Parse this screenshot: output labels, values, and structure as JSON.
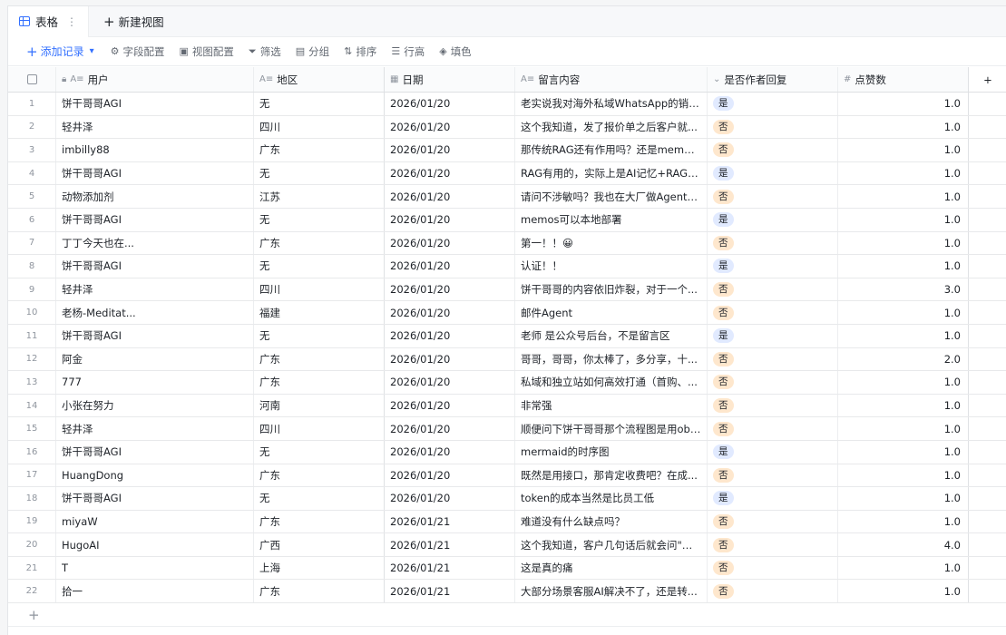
{
  "viewbar": {
    "active_tab": "表格",
    "new_view": "新建视图"
  },
  "toolbar": {
    "add_record": "添加记录",
    "field_config": "字段配置",
    "view_config": "视图配置",
    "filter": "筛选",
    "group": "分组",
    "sort": "排序",
    "row_height": "行高",
    "fill_color": "填色"
  },
  "columns": {
    "user": "用户",
    "region": "地区",
    "date": "日期",
    "message": "留言内容",
    "reply": "是否作者回复",
    "likes": "点赞数"
  },
  "colors": {
    "accent": "#3370ff",
    "tag_yes_bg": "#e1eaff",
    "tag_no_bg": "#fee7cd"
  },
  "rows": [
    {
      "no": "1",
      "user": "饼干哥哥AGI",
      "region": "无",
      "date": "2026/01/20",
      "message": "老实说我对海外私域WhatsApp的销售...",
      "reply": "是",
      "likes": "1.0"
    },
    {
      "no": "2",
      "user": "轻井泽",
      "region": "四川",
      "date": "2026/01/20",
      "message": "这个我知道，发了报价单之后客户就...",
      "reply": "否",
      "likes": "1.0"
    },
    {
      "no": "3",
      "user": "imbilly88",
      "region": "广东",
      "date": "2026/01/20",
      "message": "那传统RAG还有作用吗？还是mem使...",
      "reply": "否",
      "likes": "1.0"
    },
    {
      "no": "4",
      "user": "饼干哥哥AGI",
      "region": "无",
      "date": "2026/01/20",
      "message": "RAG有用的，实际上是AI记忆+RAG，...",
      "reply": "是",
      "likes": "1.0"
    },
    {
      "no": "5",
      "user": "动物添加剂",
      "region": "江苏",
      "date": "2026/01/20",
      "message": "请问不涉敏吗？我也在大厂做Agent，...",
      "reply": "否",
      "likes": "1.0"
    },
    {
      "no": "6",
      "user": "饼干哥哥AGI",
      "region": "无",
      "date": "2026/01/20",
      "message": "memos可以本地部署",
      "reply": "是",
      "likes": "1.0"
    },
    {
      "no": "7",
      "user": "丁丁今天也在...",
      "region": "广东",
      "date": "2026/01/20",
      "message": "第一！！😀",
      "reply": "否",
      "likes": "1.0"
    },
    {
      "no": "8",
      "user": "饼干哥哥AGI",
      "region": "无",
      "date": "2026/01/20",
      "message": "认证！！",
      "reply": "是",
      "likes": "1.0"
    },
    {
      "no": "9",
      "user": "轻井泽",
      "region": "四川",
      "date": "2026/01/20",
      "message": "饼干哥哥的内容依旧炸裂，对于一个...",
      "reply": "否",
      "likes": "3.0"
    },
    {
      "no": "10",
      "user": "老杨-Meditat...",
      "region": "福建",
      "date": "2026/01/20",
      "message": "邮件Agent",
      "reply": "否",
      "likes": "1.0"
    },
    {
      "no": "11",
      "user": "饼干哥哥AGI",
      "region": "无",
      "date": "2026/01/20",
      "message": "老师 是公众号后台，不是留言区",
      "reply": "是",
      "likes": "1.0"
    },
    {
      "no": "12",
      "user": "阿金",
      "region": "广东",
      "date": "2026/01/20",
      "message": "哥哥，哥哥，你太棒了，多分享，十...",
      "reply": "否",
      "likes": "2.0"
    },
    {
      "no": "13",
      "user": "777",
      "region": "广东",
      "date": "2026/01/20",
      "message": "私域和独立站如何高效打通（首购、...",
      "reply": "否",
      "likes": "1.0"
    },
    {
      "no": "14",
      "user": "小张在努力",
      "region": "河南",
      "date": "2026/01/20",
      "message": "非常强",
      "reply": "否",
      "likes": "1.0"
    },
    {
      "no": "15",
      "user": "轻井泽",
      "region": "四川",
      "date": "2026/01/20",
      "message": "顺便问下饼干哥哥那个流程图是用obis...",
      "reply": "否",
      "likes": "1.0"
    },
    {
      "no": "16",
      "user": "饼干哥哥AGI",
      "region": "无",
      "date": "2026/01/20",
      "message": "mermaid的时序图",
      "reply": "是",
      "likes": "1.0"
    },
    {
      "no": "17",
      "user": "HuangDong",
      "region": "广东",
      "date": "2026/01/20",
      "message": "既然是用接口，那肯定收费吧？在成...",
      "reply": "否",
      "likes": "1.0"
    },
    {
      "no": "18",
      "user": "饼干哥哥AGI",
      "region": "无",
      "date": "2026/01/20",
      "message": "token的成本当然是比员工低",
      "reply": "是",
      "likes": "1.0"
    },
    {
      "no": "19",
      "user": "miyaW",
      "region": "广东",
      "date": "2026/01/21",
      "message": "难道没有什么缺点吗？",
      "reply": "否",
      "likes": "1.0"
    },
    {
      "no": "20",
      "user": "HugoAI",
      "region": "广西",
      "date": "2026/01/21",
      "message": "这个我知道，客户几句话后就会问\"你...",
      "reply": "否",
      "likes": "4.0"
    },
    {
      "no": "21",
      "user": "T",
      "region": "上海",
      "date": "2026/01/21",
      "message": "这是真的痛",
      "reply": "否",
      "likes": "1.0"
    },
    {
      "no": "22",
      "user": "拾一",
      "region": "广东",
      "date": "2026/01/21",
      "message": "大部分场景客服AI解决不了，还是转...",
      "reply": "否",
      "likes": "1.0"
    }
  ]
}
